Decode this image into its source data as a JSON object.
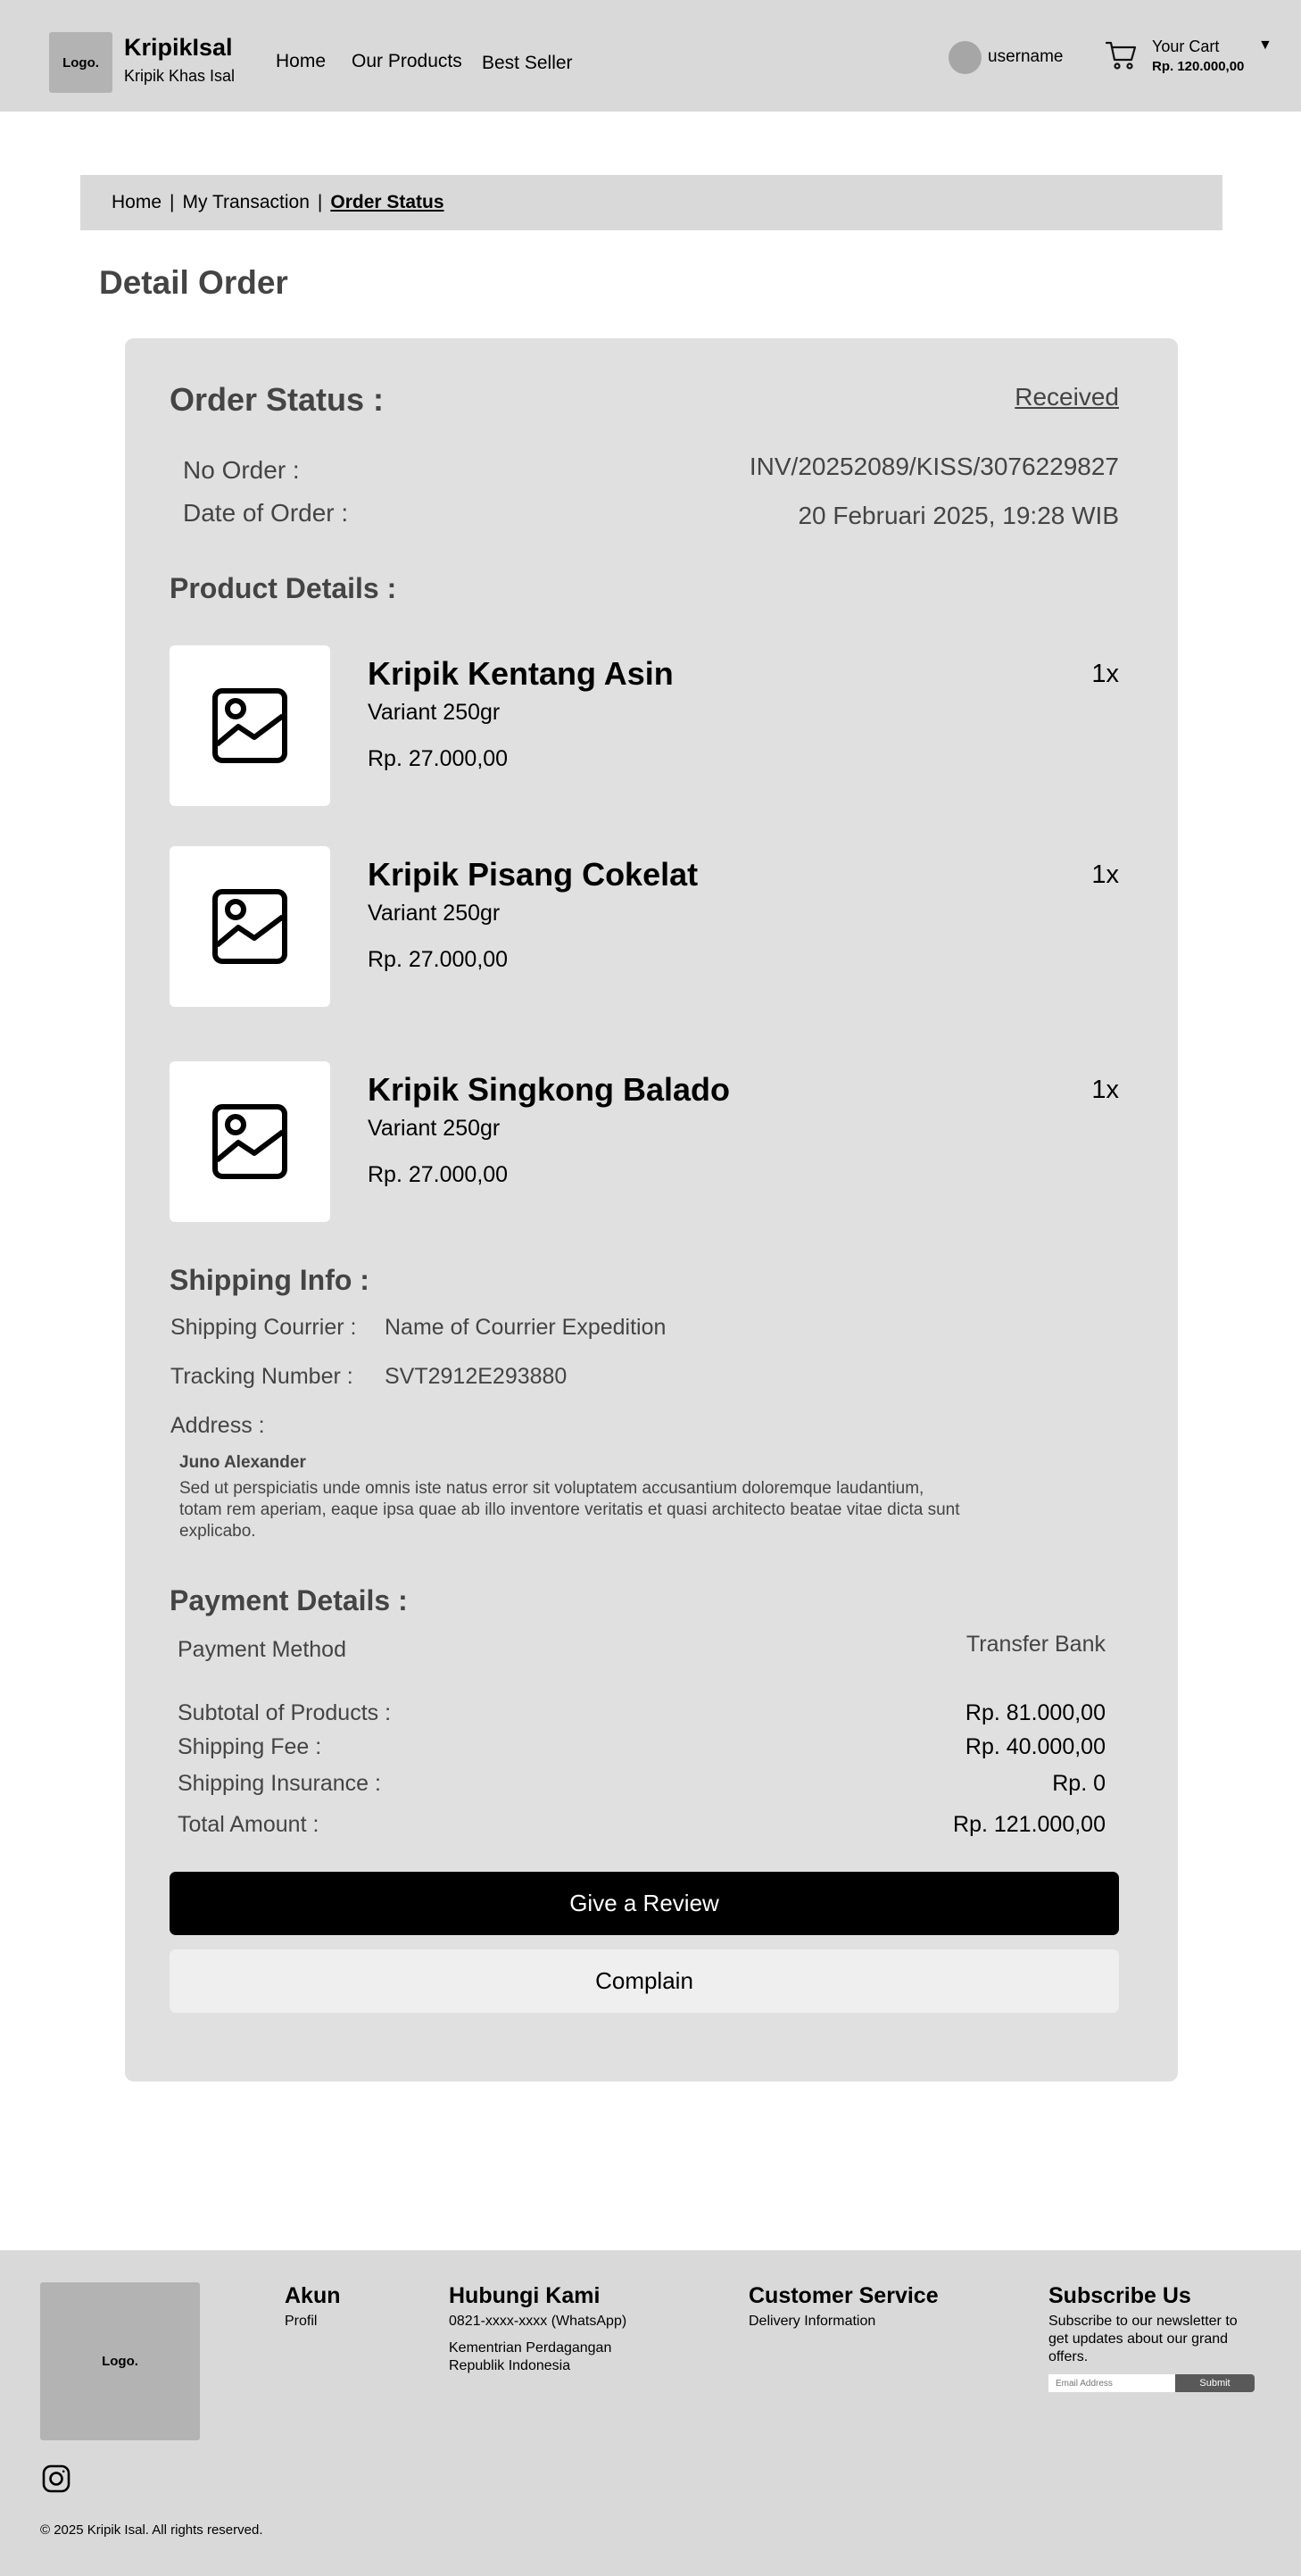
{
  "header": {
    "logo": "Logo.",
    "brand_name": "KripikIsal",
    "brand_sub": "Kripik Khas Isal",
    "nav": [
      "Home",
      "Our Products",
      "Best Seller"
    ],
    "username": "username",
    "cart_label": "Your Cart",
    "cart_total": "Rp. 120.000,00",
    "caret": "▼"
  },
  "breadcrumb": {
    "items": [
      "Home",
      "My Transaction",
      "Order Status"
    ],
    "separator": "|"
  },
  "page_title": "Detail Order",
  "order": {
    "status_title": "Order Status :",
    "status_value": "Received",
    "no_label": "No Order :",
    "no_value": "INV/20252089/KISS/3076229827",
    "date_label": "Date of Order :",
    "date_value": "20 Februari 2025, 19:28 WIB"
  },
  "products": {
    "title": "Product Details :",
    "items": [
      {
        "name": "Kripik Kentang Asin",
        "variant": "Variant 250gr",
        "price": "Rp. 27.000,00",
        "qty": "1x"
      },
      {
        "name": "Kripik Pisang Cokelat",
        "variant": "Variant 250gr",
        "price": "Rp. 27.000,00",
        "qty": "1x"
      },
      {
        "name": "Kripik Singkong Balado",
        "variant": "Variant 250gr",
        "price": "Rp. 27.000,00",
        "qty": "1x"
      }
    ]
  },
  "shipping": {
    "title": "Shipping Info :",
    "courier_label": "Shipping Courrier :",
    "courier_value": "Name of Courrier Expedition",
    "tracking_label": "Tracking Number :",
    "tracking_value": "SVT2912E293880",
    "address_label": "Address :",
    "recipient": "Juno Alexander",
    "address_line1": "Sed ut perspiciatis unde omnis iste natus error sit voluptatem  accusantium doloremque laudantium,",
    "address_line2": "totam rem aperiam, eaque ipsa quae ab illo inventore veritatis et quasi architecto beatae vitae dicta sunt",
    "address_line3": "explicabo."
  },
  "payment": {
    "title": "Payment Details :",
    "method_label": "Payment Method",
    "method_value": "Transfer Bank",
    "subtotal_label": "Subtotal of Products :",
    "subtotal_value": "Rp. 81.000,00",
    "fee_label": "Shipping Fee :",
    "fee_value": "Rp. 40.000,00",
    "insurance_label": "Shipping Insurance :",
    "insurance_value": "Rp. 0",
    "total_label": "Total Amount :",
    "total_value": "Rp. 121.000,00"
  },
  "actions": {
    "review": "Give a Review",
    "complain": "Complain"
  },
  "footer": {
    "logo": "Logo.",
    "akun_title": "Akun",
    "akun_profil": "Profil",
    "contact_title": "Hubungi Kami",
    "contact_phone": "0821-xxxx-xxxx   (WhatsApp)",
    "contact_org1": "Kementrian Perdagangan",
    "contact_org2": "Republik Indonesia",
    "cs_title": "Customer Service",
    "cs_delivery": "Delivery Information",
    "sub_title": "Subscribe Us",
    "sub_line1": "Subscribe to our newsletter to",
    "sub_line2": "get updates about our grand",
    "sub_line3": "offers.",
    "sub_placeholder": "Email Address",
    "sub_button": "Submit",
    "copyright": "© 2025 Kripik Isal. All rights reserved."
  }
}
